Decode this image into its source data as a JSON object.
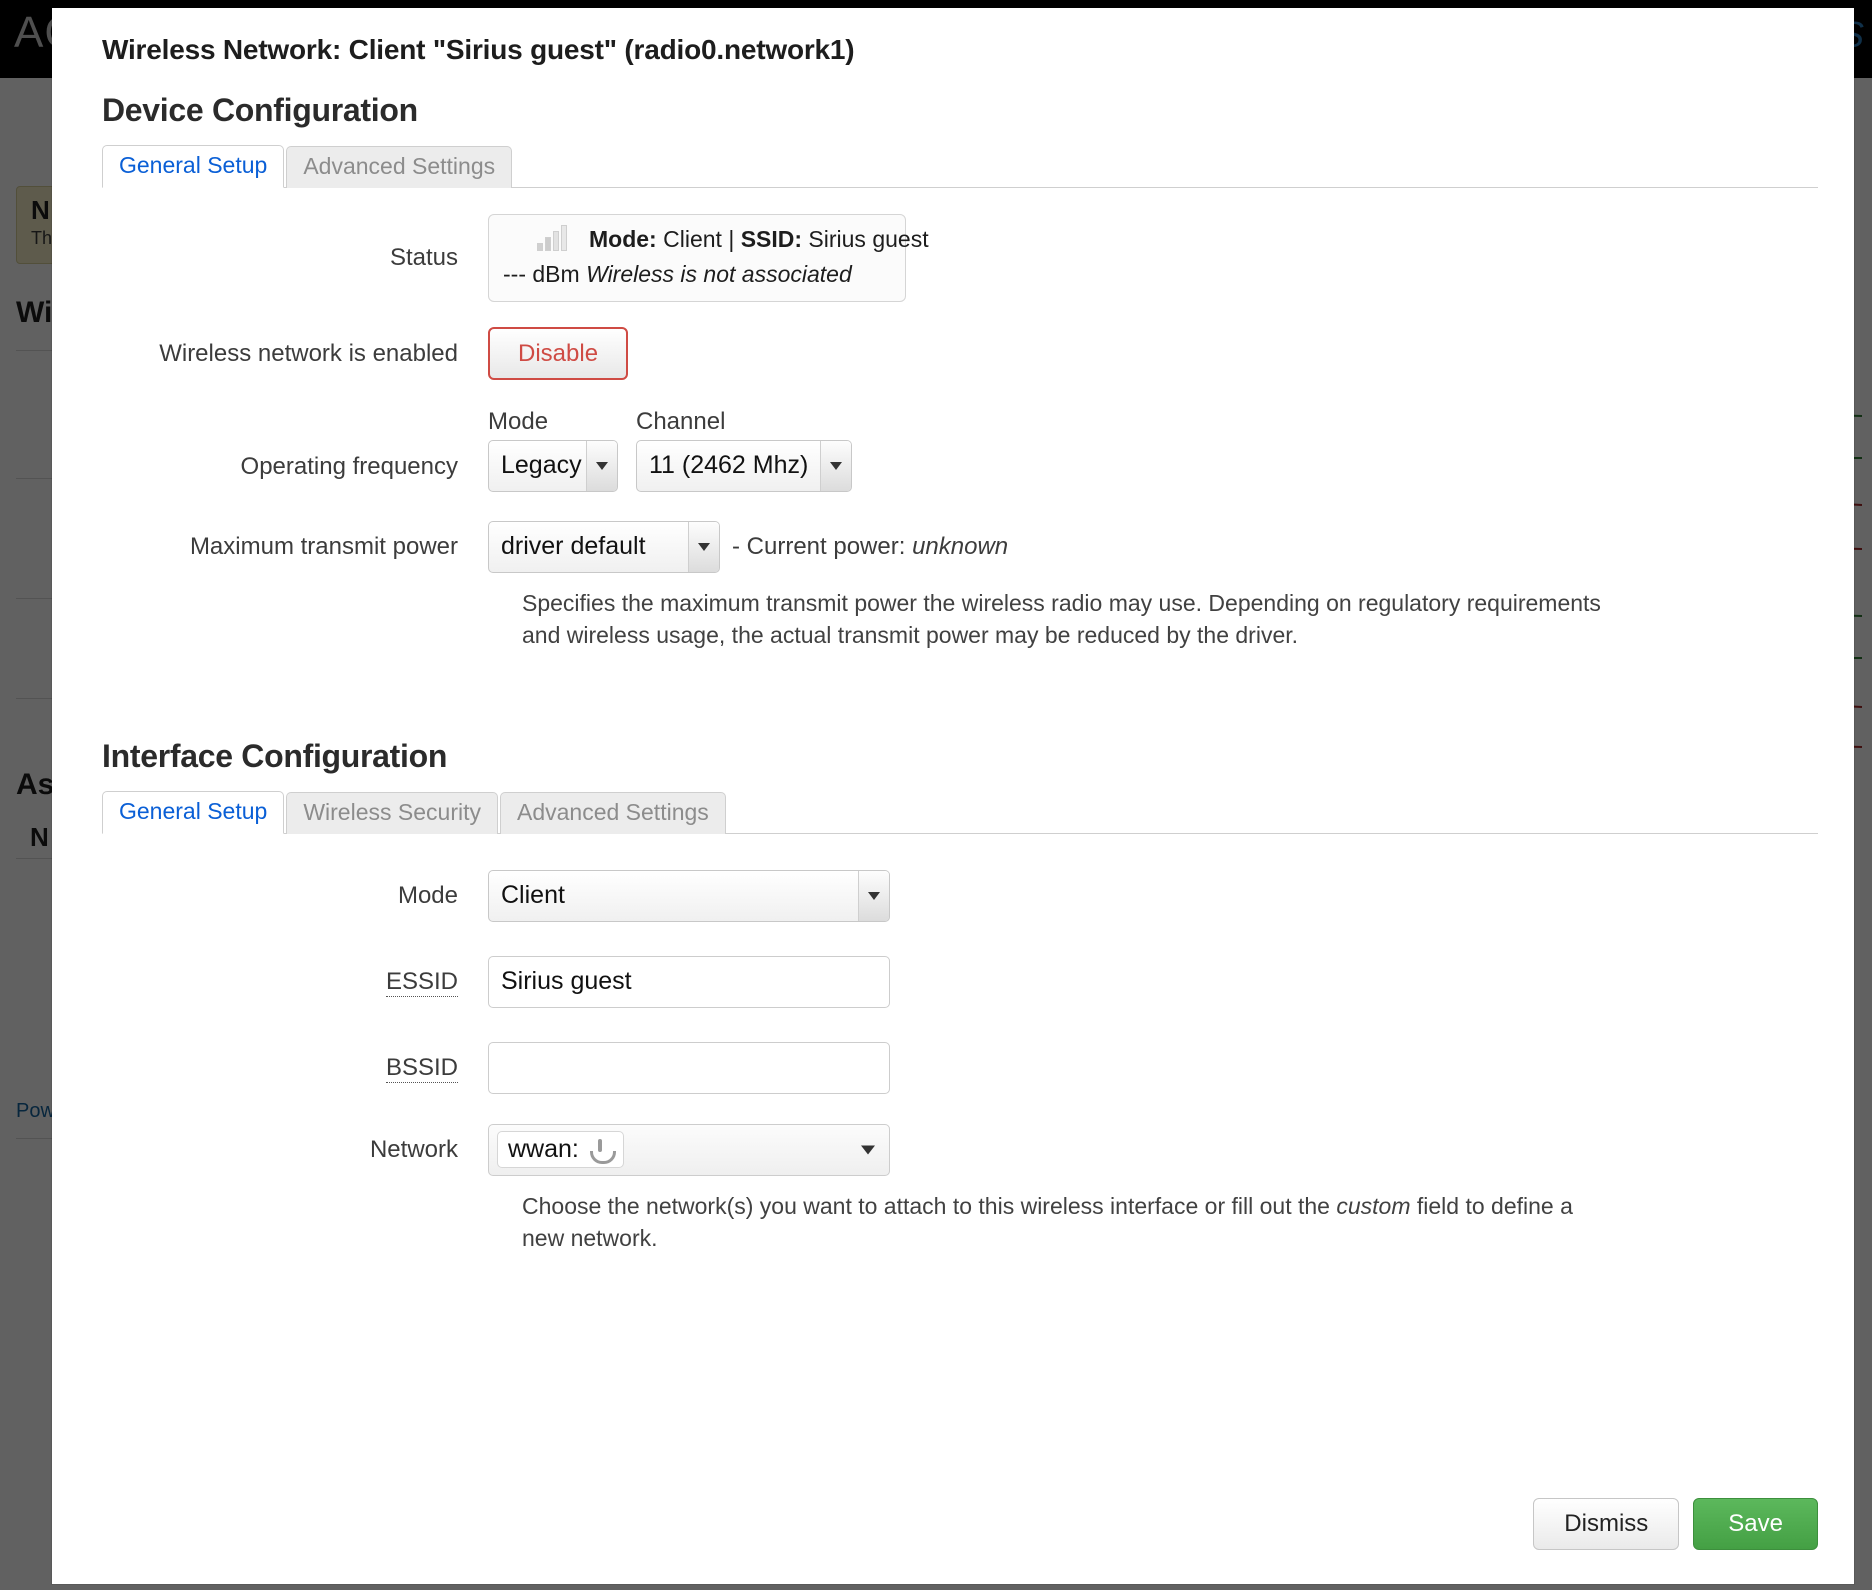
{
  "background": {
    "logo": "AC",
    "logo_right": "S",
    "notice_title": "N",
    "notice_text": "Th",
    "heading_wireless": "Wi",
    "heading_associated": "As",
    "associated_col": "N",
    "footer_link": "Pow"
  },
  "modal": {
    "title": "Wireless Network: Client \"Sirius guest\" (radio0.network1)",
    "device_section": {
      "heading": "Device Configuration",
      "tabs": [
        {
          "label": "General Setup",
          "active": true
        },
        {
          "label": "Advanced Settings",
          "active": false
        }
      ],
      "status": {
        "label": "Status",
        "icon": "signal-bars-icon",
        "mode_label": "Mode:",
        "mode_value": "Client",
        "separator": "|",
        "ssid_label": "SSID:",
        "ssid_value": "Sirius guest",
        "signal": "--- dBm",
        "state": "Wireless is not associated"
      },
      "enable": {
        "label": "Wireless network is enabled",
        "button": "Disable"
      },
      "operating_frequency": {
        "label": "Operating frequency",
        "mode_label": "Mode",
        "mode_value": "Legacy",
        "channel_label": "Channel",
        "channel_value": "11 (2462 Mhz)"
      },
      "tx_power": {
        "label": "Maximum transmit power",
        "value": "driver default",
        "current_prefix": "- Current power:",
        "current_value": "unknown",
        "description": "Specifies the maximum transmit power the wireless radio may use. Depending on regulatory requirements and wireless usage, the actual transmit power may be reduced by the driver."
      }
    },
    "interface_section": {
      "heading": "Interface Configuration",
      "tabs": [
        {
          "label": "General Setup",
          "active": true
        },
        {
          "label": "Wireless Security",
          "active": false
        },
        {
          "label": "Advanced Settings",
          "active": false
        }
      ],
      "mode": {
        "label": "Mode",
        "value": "Client"
      },
      "essid": {
        "label": "ESSID",
        "value": "Sirius guest",
        "placeholder": ""
      },
      "bssid": {
        "label": "BSSID",
        "value": "",
        "placeholder": ""
      },
      "network": {
        "label": "Network",
        "chip_label": "wwan:",
        "chip_icon": "antenna-icon",
        "description_pre": "Choose the network(s) you want to attach to this wireless interface or fill out the ",
        "description_em": "custom",
        "description_post": " field to define a new network."
      }
    },
    "footer": {
      "dismiss": "Dismiss",
      "save": "Save"
    }
  },
  "colors": {
    "accent_link": "#0a5fd6",
    "danger": "#cf4b44",
    "success": "#44a044",
    "notice_bg": "#f7f0c8"
  }
}
